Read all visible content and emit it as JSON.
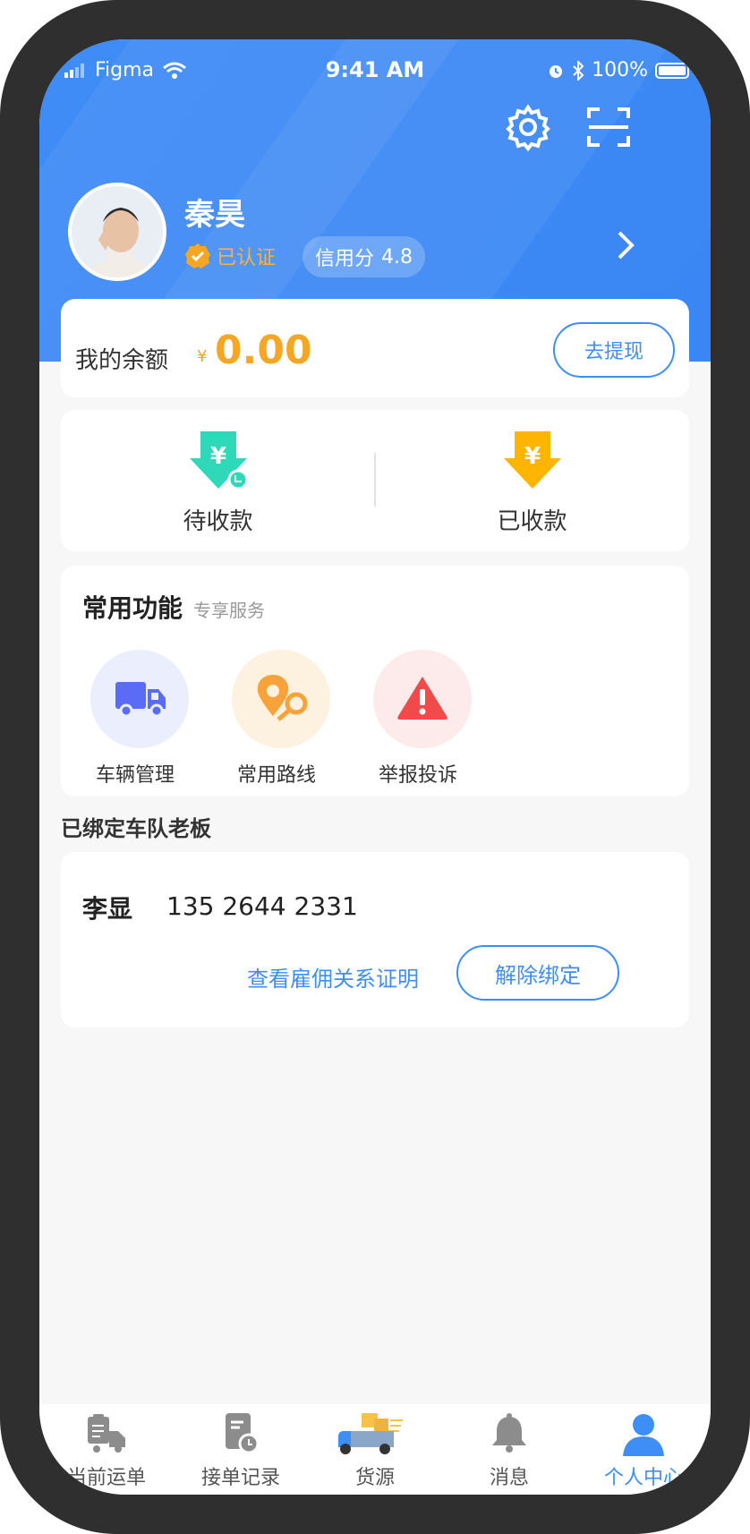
{
  "status_bar": {
    "carrier": "Figma",
    "time": "9:41 AM",
    "battery": "100%"
  },
  "header": {
    "settings_icon": "gear-icon",
    "scan_icon": "scan-icon",
    "user_name": "秦昊",
    "verified_label": "已认证",
    "credit_label": "信用分",
    "credit_score": "4.8"
  },
  "balance": {
    "label": "我的余额",
    "currency": "¥",
    "amount": "0.00",
    "withdraw_label": "去提现"
  },
  "payments": [
    {
      "label": "待收款",
      "icon": "pending-payment-icon",
      "color": "#2fd8b8"
    },
    {
      "label": "已收款",
      "icon": "received-payment-icon",
      "color": "#ffb400"
    }
  ],
  "functions": {
    "title": "常用功能",
    "subtitle": "专享服务",
    "items": [
      {
        "label": "车辆管理",
        "icon": "truck-icon",
        "color": "#5a6cf6",
        "bg": "#eaeefd"
      },
      {
        "label": "常用路线",
        "icon": "route-pin-icon",
        "color": "#f7a23a",
        "bg": "#fdf1df"
      },
      {
        "label": "举报投诉",
        "icon": "warning-icon",
        "color": "#f04a4a",
        "bg": "#fdeaea"
      }
    ]
  },
  "bound_boss": {
    "section_title": "已绑定车队老板",
    "name": "李显",
    "phone": "135 2644 2331",
    "proof_link": "查看雇佣关系证明",
    "unbind_label": "解除绑定"
  },
  "tabbar": {
    "items": [
      {
        "label": "当前运单",
        "icon": "waybill-truck-icon"
      },
      {
        "label": "接单记录",
        "icon": "order-record-icon"
      },
      {
        "label": "货源",
        "icon": "cargo-truck-icon"
      },
      {
        "label": "消息",
        "icon": "bell-icon"
      },
      {
        "label": "个人中心",
        "icon": "user-icon"
      }
    ],
    "active": "个人中心"
  },
  "colors": {
    "brand": "#3e8ef7",
    "accent": "#f5a623",
    "background": "#f7f7f7"
  }
}
